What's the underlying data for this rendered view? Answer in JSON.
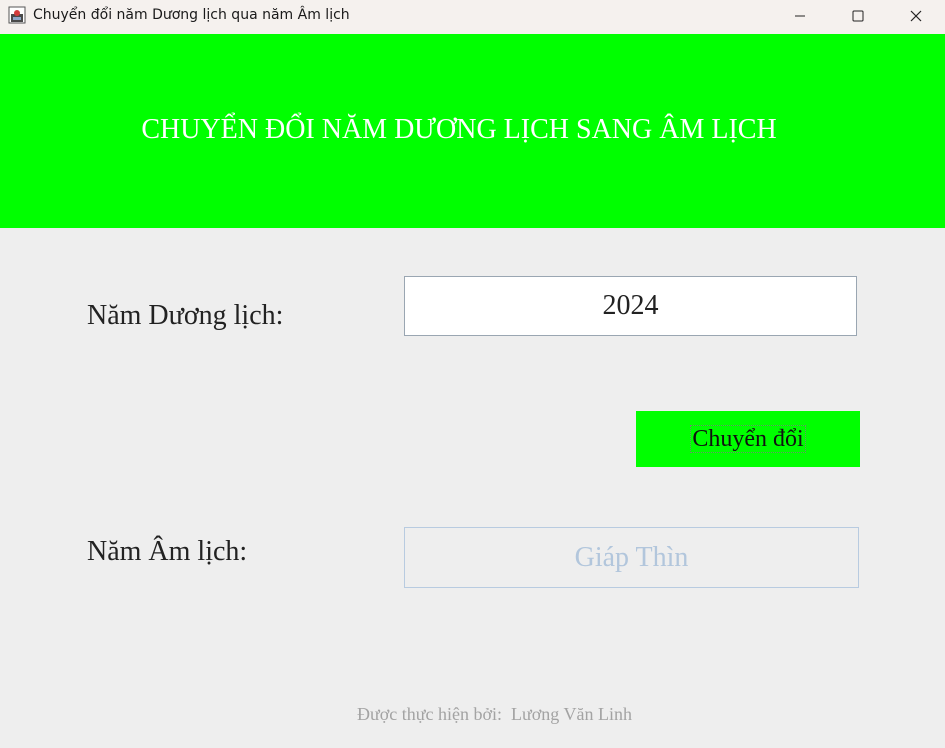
{
  "window": {
    "title": "Chuyển đổi năm Dương lịch qua năm Âm lịch",
    "icon": "java-app-icon",
    "controls": {
      "minimize": "minimize-icon",
      "maximize": "maximize-icon",
      "close": "close-icon"
    }
  },
  "header": {
    "title": "CHUYỂN ĐỔI NĂM DƯƠNG LỊCH SANG ÂM LỊCH",
    "background": "#00ff00",
    "text_color": "#ffffff"
  },
  "form": {
    "solar_label": "Năm Dương lịch:",
    "solar_value": "2024",
    "convert_label": "Chuyển đổi",
    "button_color": "#00ff00",
    "lunar_label": "Năm Âm lịch:",
    "lunar_value": "Giáp Thìn"
  },
  "footer": {
    "text": "Được thực hiện bởi:  Lương Văn Linh"
  }
}
